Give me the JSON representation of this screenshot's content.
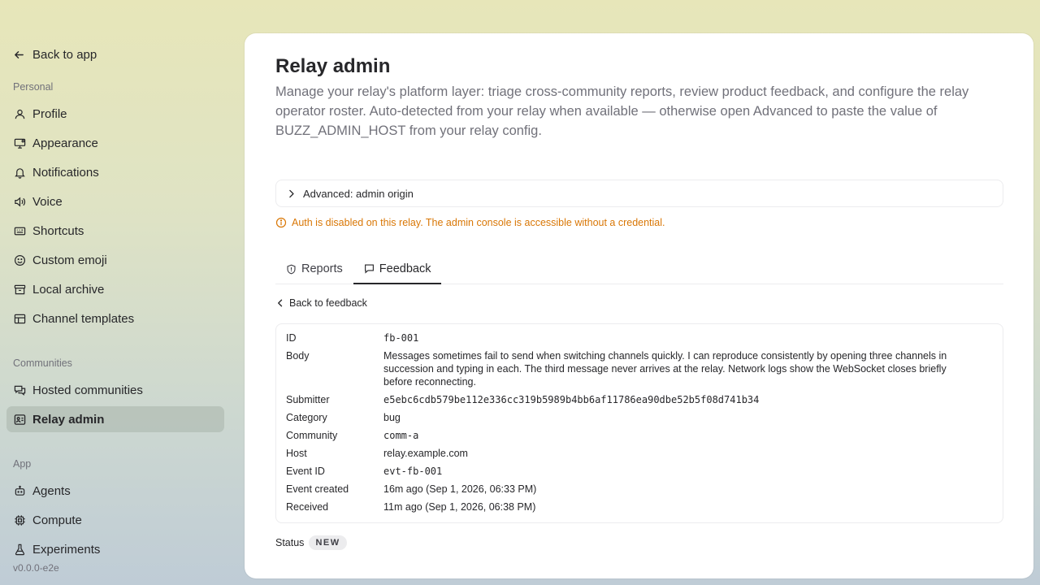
{
  "sidebar": {
    "back_label": "Back to app",
    "sections": {
      "personal": "Personal",
      "communities": "Communities",
      "app": "App"
    },
    "personal_items": [
      {
        "label": "Profile",
        "icon": "user-icon"
      },
      {
        "label": "Appearance",
        "icon": "monitor-icon"
      },
      {
        "label": "Notifications",
        "icon": "bell-icon"
      },
      {
        "label": "Voice",
        "icon": "speaker-icon"
      },
      {
        "label": "Shortcuts",
        "icon": "keyboard-icon"
      },
      {
        "label": "Custom emoji",
        "icon": "smile-icon"
      },
      {
        "label": "Local archive",
        "icon": "archive-icon"
      },
      {
        "label": "Channel templates",
        "icon": "layout-icon"
      }
    ],
    "community_items": [
      {
        "label": "Hosted communities",
        "icon": "chat-icon"
      },
      {
        "label": "Relay admin",
        "icon": "server-icon",
        "active": true
      }
    ],
    "app_items": [
      {
        "label": "Agents",
        "icon": "bot-icon"
      },
      {
        "label": "Compute",
        "icon": "cpu-icon"
      },
      {
        "label": "Experiments",
        "icon": "flask-icon"
      }
    ],
    "version": "v0.0.0-e2e"
  },
  "main": {
    "title": "Relay admin",
    "description": "Manage your relay's platform layer: triage cross-community reports, review product feedback, and configure the relay operator roster. Auto-detected from your relay when available — otherwise open Advanced to paste the value of BUZZ_ADMIN_HOST from your relay config.",
    "advanced_label": "Advanced: admin origin",
    "warning": "Auth is disabled on this relay. The admin console is accessible without a credential.",
    "tabs": [
      {
        "label": "Reports",
        "icon": "shield-icon"
      },
      {
        "label": "Feedback",
        "icon": "message-icon",
        "active": true
      }
    ],
    "back_to_feedback": "Back to feedback",
    "details": [
      {
        "key": "ID",
        "value": "fb-001",
        "mono": true
      },
      {
        "key": "Body",
        "value": "Messages sometimes fail to send when switching channels quickly. I can reproduce consistently by opening three channels in succession and typing in each. The third message never arrives at the relay. Network logs show the WebSocket closes briefly before reconnecting.",
        "mono": false
      },
      {
        "key": "Submitter",
        "value": "e5ebc6cdb579be112e336cc319b5989b4bb6af11786ea90dbe52b5f08d741b34",
        "mono": true
      },
      {
        "key": "Category",
        "value": "bug",
        "mono": false
      },
      {
        "key": "Community",
        "value": "comm-a",
        "mono": true
      },
      {
        "key": "Host",
        "value": "relay.example.com",
        "mono": false
      },
      {
        "key": "Event ID",
        "value": "evt-fb-001",
        "mono": true
      },
      {
        "key": "Event created",
        "value": "16m ago (Sep 1, 2026, 06:33 PM)",
        "mono": false
      },
      {
        "key": "Received",
        "value": "11m ago (Sep 1, 2026, 06:38 PM)",
        "mono": false
      }
    ],
    "status_label": "Status",
    "status_value": "NEW"
  },
  "colors": {
    "warning": "#d97706",
    "active_nav_bg": "#c3c8bd"
  }
}
